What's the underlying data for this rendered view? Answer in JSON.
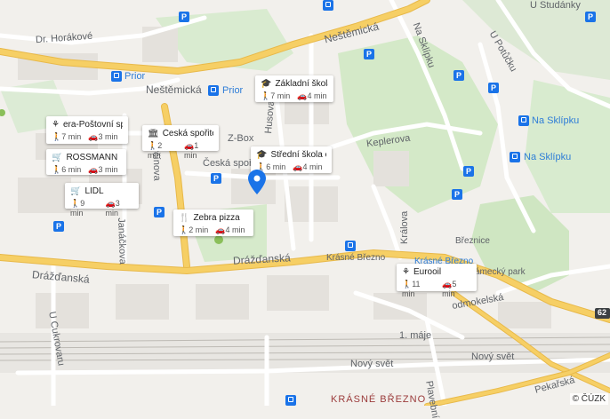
{
  "streets": {
    "dr_horakove": "Dr. Horákové",
    "nestemicka_top": "Neštěmická",
    "nestemicka_left": "Neštěmická",
    "prior_1": "Prior",
    "prior_2": "Prior",
    "husova": "Husova",
    "keplerova_top": "Keplerova",
    "keplerova_mid": "Keplerova",
    "na_sklipku_top": "Na Sklípku",
    "na_sklipku_1": "Na Sklípku",
    "na_sklipku_2": "Na Sklípku",
    "u_potucku": "U Potůčku",
    "u_studanky": "U Studánky",
    "z_box": "Z-Box",
    "ceska_sporitelna_map": "Česká spořite",
    "krcinova": "Krčínova",
    "janackova": "Janáčkova",
    "drazdanska_center": "Drážďanská",
    "drazdanska_left": "Drážďanská",
    "krasne_brezno_stop": "Krásné Březno",
    "krasne_brezno_blue": "Krásné Březno",
    "brezince": "Březnice",
    "kralova": "Králova",
    "zamecky_park": "ámecký park",
    "rodmokelska": "odmokelská",
    "u_cukrovaru": "U Cukrovaru",
    "prvniho_maje": "1. máje",
    "novy_svet_1": "Nový svět",
    "novy_svet_2": "Nový svět",
    "krasne_brezno_district": "KRÁSNÉ BŘEZNO",
    "pekarska": "Pekařská",
    "plavebni": "Plavební",
    "road_62": "62"
  },
  "cards": [
    {
      "name": "era-Poštovní spoř...",
      "icon": "atm-icon",
      "walk": "7 min",
      "drive": "3 min"
    },
    {
      "name": "Česká spořitelna",
      "icon": "bank-icon",
      "walk": "2 min",
      "drive": "1 min"
    },
    {
      "name": "ROSSMANN",
      "icon": "cart-icon",
      "walk": "6 min",
      "drive": "3 min"
    },
    {
      "name": "LIDL",
      "icon": "cart-icon",
      "walk": "9 min",
      "drive": "3 min"
    },
    {
      "name": "Zebra pizza",
      "icon": "restaurant-icon",
      "walk": "2 min",
      "drive": "4 min"
    },
    {
      "name": "Základní škola a ...",
      "icon": "school-icon",
      "walk": "7 min",
      "drive": "4 min"
    },
    {
      "name": "Střední škola obc...",
      "icon": "school-icon",
      "walk": "6 min",
      "drive": "4 min"
    },
    {
      "name": "Eurooil",
      "icon": "fuel-icon",
      "walk": "11 min",
      "drive": "5 min"
    }
  ],
  "parking_label": "P",
  "copyright": "© ČÚZK",
  "colors": {
    "marker": "#1a73e8",
    "road_yellow": "#f6cf65",
    "park_green": "#cfe8c4",
    "water": "#aadaff"
  }
}
